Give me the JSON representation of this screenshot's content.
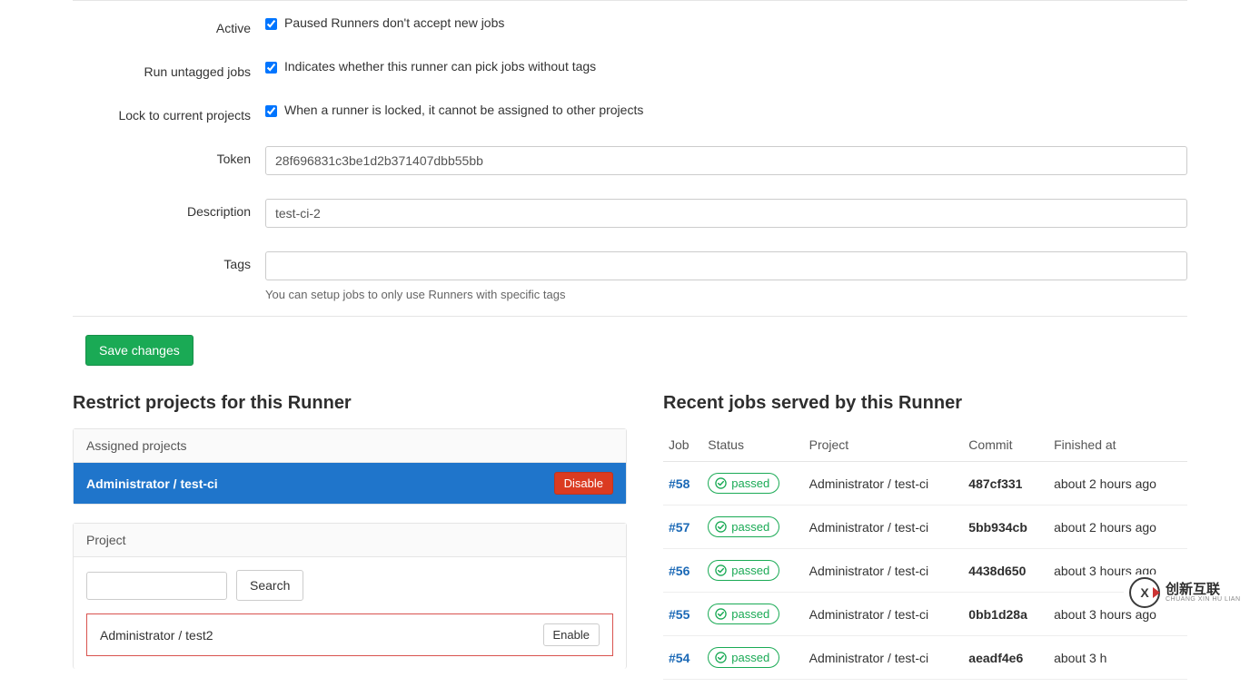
{
  "form": {
    "active": {
      "label": "Active",
      "checked": true,
      "desc": "Paused Runners don't accept new jobs"
    },
    "untagged": {
      "label": "Run untagged jobs",
      "checked": true,
      "desc": "Indicates whether this runner can pick jobs without tags"
    },
    "locked": {
      "label": "Lock to current projects",
      "checked": true,
      "desc": "When a runner is locked, it cannot be assigned to other projects"
    },
    "token": {
      "label": "Token",
      "value": "28f696831c3be1d2b371407dbb55bb"
    },
    "description": {
      "label": "Description",
      "value": "test-ci-2"
    },
    "tags": {
      "label": "Tags",
      "value": "",
      "helper": "You can setup jobs to only use Runners with specific tags"
    },
    "save_label": "Save changes"
  },
  "restrict": {
    "title": "Restrict projects for this Runner",
    "assigned_header": "Assigned projects",
    "assigned_project": "Administrator / test-ci",
    "disable_label": "Disable",
    "project_header": "Project",
    "search_value": "",
    "search_label": "Search",
    "candidate_project": "Administrator / test2",
    "enable_label": "Enable"
  },
  "jobs": {
    "title": "Recent jobs served by this Runner",
    "headers": {
      "job": "Job",
      "status": "Status",
      "project": "Project",
      "commit": "Commit",
      "finished": "Finished at"
    },
    "status_label": "passed",
    "rows": [
      {
        "id": "#58",
        "status": "passed",
        "project": "Administrator / test-ci",
        "commit": "487cf331",
        "finished": "about 2 hours ago"
      },
      {
        "id": "#57",
        "status": "passed",
        "project": "Administrator / test-ci",
        "commit": "5bb934cb",
        "finished": "about 2 hours ago"
      },
      {
        "id": "#56",
        "status": "passed",
        "project": "Administrator / test-ci",
        "commit": "4438d650",
        "finished": "about 3 hours ago"
      },
      {
        "id": "#55",
        "status": "passed",
        "project": "Administrator / test-ci",
        "commit": "0bb1d28a",
        "finished": "about 3 hours ago"
      },
      {
        "id": "#54",
        "status": "passed",
        "project": "Administrator / test-ci",
        "commit": "aeadf4e6",
        "finished": "about 3 h"
      }
    ]
  },
  "watermark": {
    "big": "创新互联",
    "small": "CHUANG XIN HU LIAN",
    "glyph": "X"
  }
}
